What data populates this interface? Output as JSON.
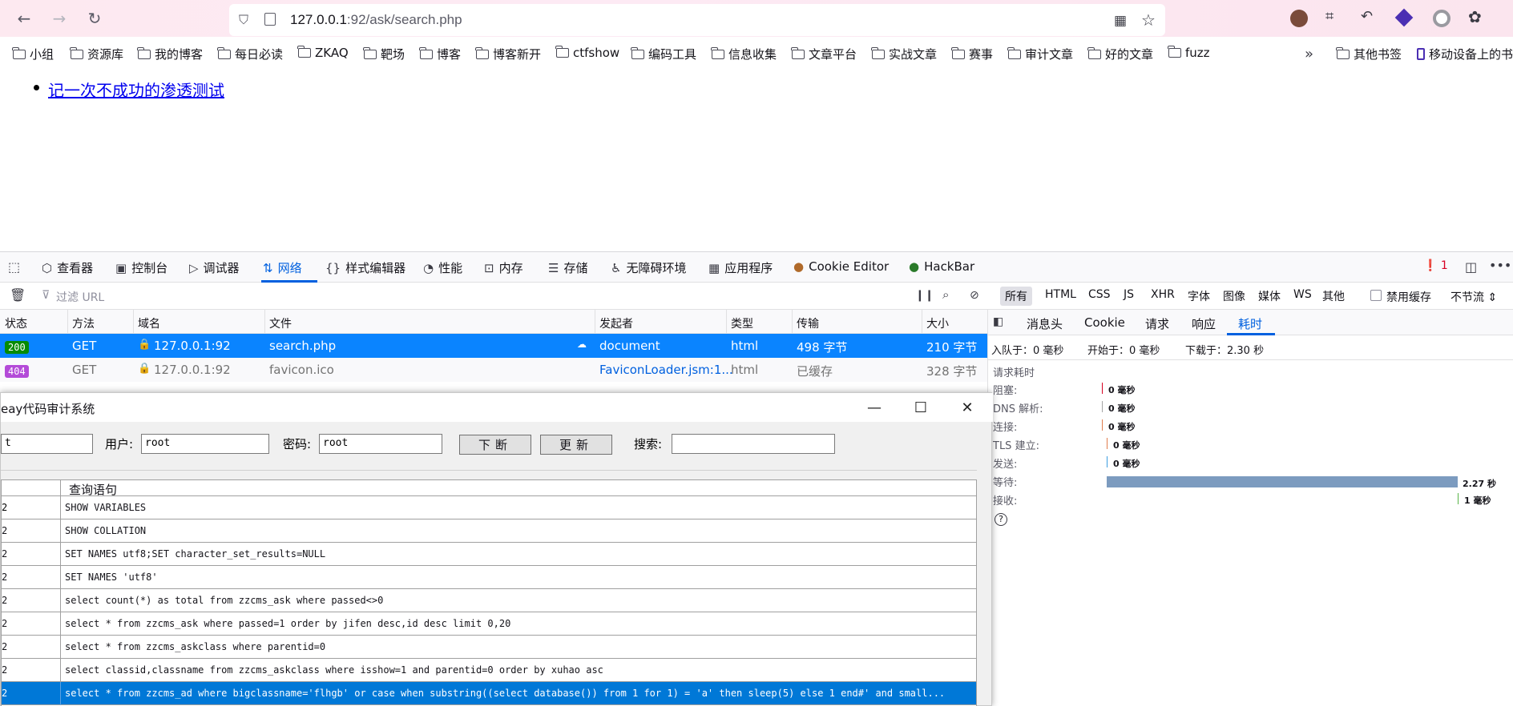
{
  "browser": {
    "url_host": "127.0.0.1",
    "url_rest": ":92/ask/search.php"
  },
  "bookmarks": [
    "小组",
    "资源库",
    "我的博客",
    "每日必读",
    "ZKAQ",
    "靶场",
    "博客",
    "博客新开",
    "ctfshow",
    "编码工具",
    "信息收集",
    "文章平台",
    "实战文章",
    "赛事",
    "审计文章",
    "好的文章",
    "fuzz"
  ],
  "bookmarks_right": [
    "其他书签",
    "移动设备上的书"
  ],
  "page": {
    "link_text": "记一次不成功的渗透测试"
  },
  "devtools": {
    "tabs": [
      "查看器",
      "控制台",
      "调试器",
      "网络",
      "样式编辑器",
      "性能",
      "内存",
      "存储",
      "无障碍环境",
      "应用程序",
      "Cookie Editor",
      "HackBar"
    ],
    "error_count": "1",
    "filter_placeholder": "过滤 URL",
    "filter_types": [
      "所有",
      "HTML",
      "CSS",
      "JS",
      "XHR",
      "字体",
      "图像",
      "媒体",
      "WS",
      "其他"
    ],
    "disable_cache": "禁用缓存",
    "throttle": "不节流 ⇕",
    "columns": [
      "状态",
      "方法",
      "域名",
      "文件",
      "发起者",
      "类型",
      "传输",
      "大小"
    ],
    "requests": [
      {
        "status": "200",
        "method": "GET",
        "domain": "127.0.0.1:92",
        "file": "search.php",
        "initiator": "document",
        "type": "html",
        "transfer": "498 字节",
        "size": "210 字节"
      },
      {
        "status": "404",
        "method": "GET",
        "domain": "127.0.0.1:92",
        "file": "favicon.ico",
        "initiator": "FaviconLoader.jsm:1...",
        "type": "html",
        "transfer": "已缓存",
        "size": "328 字节"
      }
    ],
    "side_tabs": [
      "消息头",
      "Cookie",
      "请求",
      "响应",
      "耗时"
    ],
    "queued": "入队于：0 毫秒",
    "started": "开始于：0 毫秒",
    "downloaded": "下载于：2.30 秒",
    "timing_title": "请求耗时",
    "timings": [
      {
        "label": "阻塞:",
        "value": "0 毫秒"
      },
      {
        "label": "DNS 解析:",
        "value": "0 毫秒"
      },
      {
        "label": "连接:",
        "value": "0 毫秒"
      },
      {
        "label": "TLS 建立:",
        "value": "0 毫秒"
      },
      {
        "label": "发送:",
        "value": "0 毫秒"
      },
      {
        "label": "等待:",
        "value": "2.27 秒"
      },
      {
        "label": "接收:",
        "value": "1 毫秒"
      }
    ]
  },
  "seay": {
    "title": "eay代码审计系统",
    "host_value": "t",
    "user_label": "用户:",
    "user_value": "root",
    "pass_label": "密码:",
    "pass_value": "root",
    "btn_break": "下断",
    "btn_update": "更新",
    "search_label": "搜索:",
    "column_query": "查询语句",
    "rows": [
      {
        "num": "2",
        "query": "SHOW VARIABLES"
      },
      {
        "num": "2",
        "query": "SHOW COLLATION"
      },
      {
        "num": "2",
        "query": "SET NAMES utf8;SET character_set_results=NULL"
      },
      {
        "num": "2",
        "query": "SET NAMES 'utf8'"
      },
      {
        "num": "2",
        "query": "select count(*) as total from zzcms_ask where passed<>0"
      },
      {
        "num": "2",
        "query": "select * from zzcms_ask where passed=1 order by jifen desc,id desc  limit 0,20"
      },
      {
        "num": "2",
        "query": "select * from zzcms_askclass where parentid=0"
      },
      {
        "num": "2",
        "query": "select classid,classname from zzcms_askclass where isshow=1 and parentid=0 order by xuhao asc"
      },
      {
        "num": "2",
        "query": "select * from zzcms_ad where bigclassname='flhgb' or case when substring((select database()) from 1 for 1) = 'a' then sleep(5) else 1 end#' and small..."
      }
    ]
  }
}
